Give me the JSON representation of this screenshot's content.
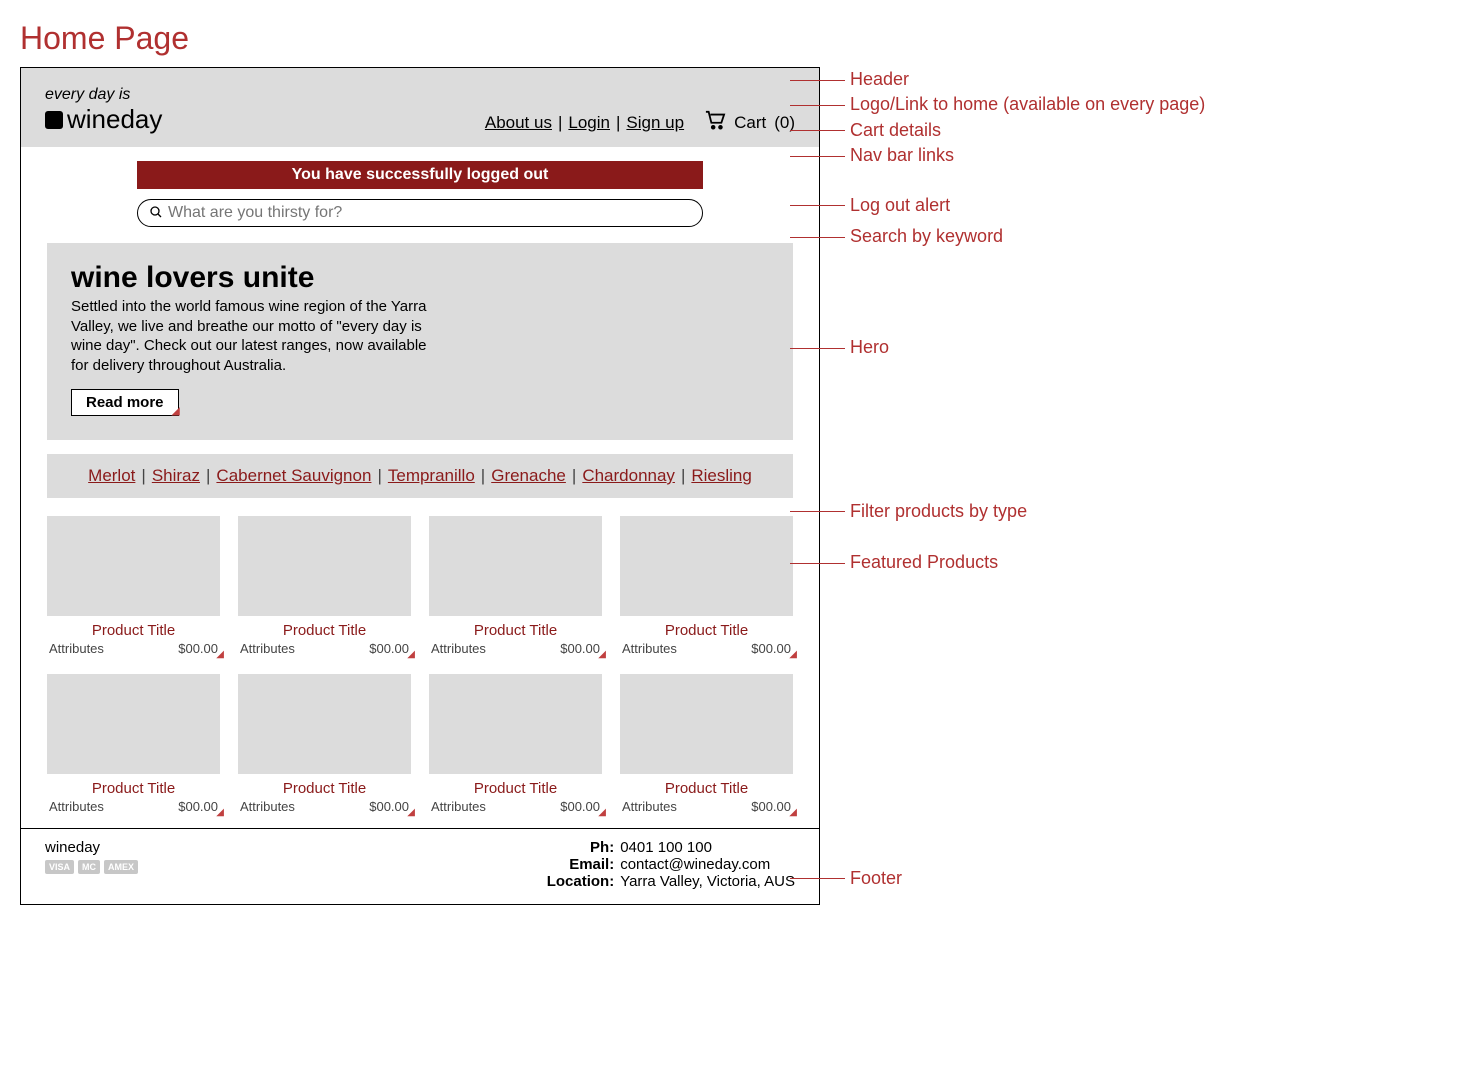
{
  "page_label": "Home Page",
  "header": {
    "tagline": "every day is",
    "brand": "wineday",
    "nav_links": [
      "About us",
      "Login",
      "Sign up"
    ],
    "cart_label": "Cart",
    "cart_count": "(0)"
  },
  "alert": {
    "text": "You have successfully logged out"
  },
  "search": {
    "placeholder": "What are you thirsty for?"
  },
  "hero": {
    "title": "wine lovers unite",
    "body": "Settled into the world famous wine region of the Yarra Valley, we live and breathe our motto of \"every day is wine day\". Check out our latest ranges, now available for delivery throughout Australia.",
    "button": "Read more"
  },
  "filters": [
    "Merlot",
    "Shiraz",
    "Cabernet Sauvignon",
    "Tempranillo",
    "Grenache",
    "Chardonnay",
    "Riesling"
  ],
  "products": [
    {
      "title": "Product Title",
      "attributes": "Attributes",
      "price": "$00.00"
    },
    {
      "title": "Product Title",
      "attributes": "Attributes",
      "price": "$00.00"
    },
    {
      "title": "Product Title",
      "attributes": "Attributes",
      "price": "$00.00"
    },
    {
      "title": "Product Title",
      "attributes": "Attributes",
      "price": "$00.00"
    },
    {
      "title": "Product Title",
      "attributes": "Attributes",
      "price": "$00.00"
    },
    {
      "title": "Product Title",
      "attributes": "Attributes",
      "price": "$00.00"
    },
    {
      "title": "Product Title",
      "attributes": "Attributes",
      "price": "$00.00"
    },
    {
      "title": "Product Title",
      "attributes": "Attributes",
      "price": "$00.00"
    }
  ],
  "footer": {
    "brand": "wineday",
    "payment_badges": [
      "VISA",
      "MC",
      "AMEX"
    ],
    "contact": {
      "ph_label": "Ph:",
      "ph": "0401 100 100",
      "email_label": "Email:",
      "email": "contact@wineday.com",
      "location_label": "Location:",
      "location": "Yarra Valley, Victoria, AUS"
    }
  },
  "annotations": {
    "header": "Header",
    "logo": "Logo/Link to home (available on every page)",
    "cart": "Cart details",
    "nav": "Nav bar links",
    "alert": "Log out alert",
    "search": "Search by keyword",
    "hero": "Hero",
    "filter": "Filter products by type",
    "products": "Featured Products",
    "footer": "Footer"
  }
}
